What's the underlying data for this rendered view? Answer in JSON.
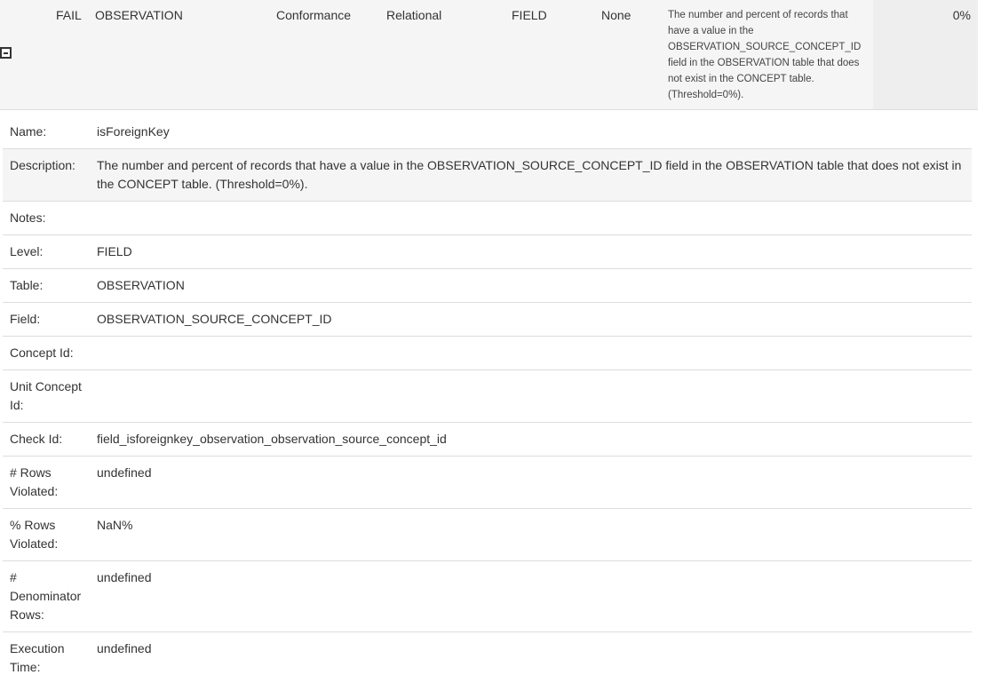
{
  "summary": {
    "status": "FAIL",
    "table": "OBSERVATION",
    "category": "Conformance",
    "subcategory": "Relational",
    "level": "FIELD",
    "context": "None",
    "description": "The number and percent of records that have a value in the OBSERVATION_SOURCE_CONCEPT_ID field in the OBSERVATION table that does not exist in the CONCEPT table. (Threshold=0%).",
    "percent": "0%"
  },
  "details": [
    {
      "label": "Name:",
      "value": "isForeignKey"
    },
    {
      "label": "Description:",
      "value": "The number and percent of records that have a value in the OBSERVATION_SOURCE_CONCEPT_ID field in the OBSERVATION table that does not exist in the CONCEPT table. (Threshold=0%)."
    },
    {
      "label": "Notes:",
      "value": ""
    },
    {
      "label": "Level:",
      "value": "FIELD"
    },
    {
      "label": "Table:",
      "value": "OBSERVATION"
    },
    {
      "label": "Field:",
      "value": "OBSERVATION_SOURCE_CONCEPT_ID"
    },
    {
      "label": "Concept Id:",
      "value": ""
    },
    {
      "label": "Unit Concept Id:",
      "value": ""
    },
    {
      "label": "Check Id:",
      "value": "field_isforeignkey_observation_observation_source_concept_id"
    },
    {
      "label": "# Rows Violated:",
      "value": "undefined"
    },
    {
      "label": "% Rows Violated:",
      "value": "NaN%"
    },
    {
      "label": "# Denominator Rows:",
      "value": "undefined"
    },
    {
      "label": "Execution Time:",
      "value": "undefined"
    }
  ]
}
